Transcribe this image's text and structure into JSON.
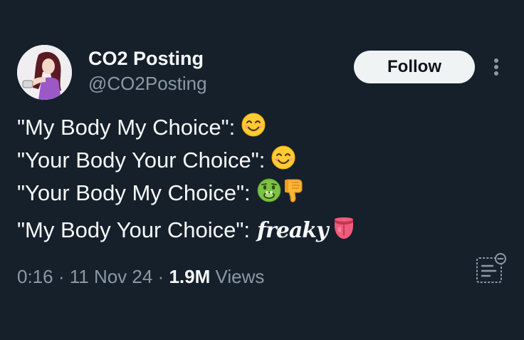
{
  "author": {
    "display_name": "CO2 Posting",
    "handle": "@CO2Posting",
    "avatar_icon": "avatar-icon"
  },
  "follow_button": {
    "label": "Follow"
  },
  "more_button": {
    "icon": "more-vertical-icon"
  },
  "tweet": {
    "lines": [
      {
        "text": "\"My Body My Choice\":",
        "emojis": [
          "smiling-face-icon"
        ]
      },
      {
        "text": "\"Your Body Your Choice\":",
        "emojis": [
          "smiling-face-icon"
        ]
      },
      {
        "text": "\"Your Body My Choice\":",
        "emojis": [
          "nauseated-face-icon",
          "thumbs-down-icon"
        ]
      },
      {
        "text": "\"My Body Your Choice\":",
        "freaky_text": "freaky",
        "emojis": [
          "tongue-icon"
        ]
      }
    ]
  },
  "meta": {
    "time": "0:16",
    "date": "11 Nov 24",
    "views_count": "1.9M",
    "views_label": "Views"
  },
  "analytics_button": {
    "icon": "analytics-icon"
  },
  "colors": {
    "background": "#15202b",
    "text_primary": "#f7f9f9",
    "text_secondary": "#8b98a5",
    "button_bg": "#eff3f4",
    "button_text": "#0f1419"
  }
}
